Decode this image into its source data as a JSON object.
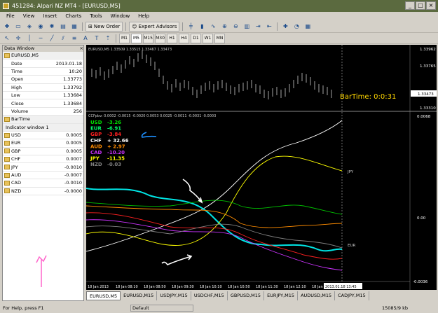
{
  "window": {
    "title": "451284: Alpari NZ MT4 - [EURUSD,M5]"
  },
  "menu": [
    "File",
    "View",
    "Insert",
    "Charts",
    "Tools",
    "Window",
    "Help"
  ],
  "toolbar": {
    "new_order": "New Order",
    "expert_advisors": "Expert Advisors",
    "timeframes": [
      "M1",
      "M5",
      "M15",
      "M30",
      "H1",
      "H4",
      "D1",
      "W1",
      "MN"
    ],
    "active_timeframe": "M5"
  },
  "data_window": {
    "title": "Data Window",
    "symbol": "EURUSD,M5",
    "rows": [
      {
        "k": "Date",
        "v": "2013.01.18"
      },
      {
        "k": "Time",
        "v": "10:20"
      },
      {
        "k": "Open",
        "v": "1.33773"
      },
      {
        "k": "High",
        "v": "1.33792"
      },
      {
        "k": "Low",
        "v": "1.33684"
      },
      {
        "k": "Close",
        "v": "1.33684"
      },
      {
        "k": "Volume",
        "v": "256"
      }
    ],
    "bartime_label": "BarTime",
    "indicator_label": "Indicator window 1",
    "indicators": [
      {
        "k": "USD",
        "v": "0.0005"
      },
      {
        "k": "EUR",
        "v": "0.0005"
      },
      {
        "k": "GBP",
        "v": "0.0005"
      },
      {
        "k": "CHF",
        "v": "0.0007"
      },
      {
        "k": "JPY",
        "v": "-0.0010"
      },
      {
        "k": "AUD",
        "v": "-0.0007"
      },
      {
        "k": "CAD",
        "v": "-0.0010"
      },
      {
        "k": "NZD",
        "v": "-0.0000"
      }
    ]
  },
  "chart": {
    "header": "EURUSD,M5  1.33509 1.33515 1.33467 1.33473",
    "price_labels": [
      "1.33962",
      "1.33765",
      "1.33473",
      "1.33310"
    ],
    "bartime": "BarTime:  0:0:31",
    "indicator_header": "CCFpbv: 0.0002 -0.0015 -0.0020 0.0053 0.0025 -0.0011 -0.0031 -0.0003",
    "indicator_scale": [
      "0.0068",
      "0.00",
      "-0.0036"
    ],
    "currencies": [
      {
        "name": "USD",
        "value": "-3.26",
        "color": "#00e000"
      },
      {
        "name": "EUR",
        "value": "-6.91",
        "color": "#00ff66"
      },
      {
        "name": "GBP",
        "value": "-3.84",
        "color": "#ff2020"
      },
      {
        "name": "CHF",
        "value": "+ 32.66",
        "color": "#ffffff"
      },
      {
        "name": "AUD",
        "value": "+ 2.97",
        "color": "#ff8c00"
      },
      {
        "name": "CAD",
        "value": "-10.20",
        "color": "#cc33ff"
      },
      {
        "name": "JPY",
        "value": "-11.35",
        "color": "#ffff00"
      },
      {
        "name": "NZD",
        "value": "-0.03",
        "color": "#808080"
      }
    ],
    "line_labels": {
      "jpy": "JPY",
      "eur": "EUR"
    },
    "time_axis": [
      "18 Jan 2013",
      "18 Jan 08:10",
      "18 Jan 08:50",
      "18 Jan 09:30",
      "18 Jan 10:10",
      "18 Jan 10:50",
      "18 Jan 11:30",
      "18 Jan 12:10",
      "18 Jan 12:50"
    ],
    "cursor_time": "2013.01.18 13:45"
  },
  "tabs": [
    "EURUSD,M5",
    "EURUSD,M15",
    "USDJPY,M15",
    "USDCHF,M15",
    "GBPUSD,M15",
    "EURJPY,M15",
    "AUDUSD,M15",
    "CADJPY,M15"
  ],
  "status": {
    "help": "For Help, press F1",
    "profile": "Default",
    "traffic": "15085/9 kb"
  }
}
